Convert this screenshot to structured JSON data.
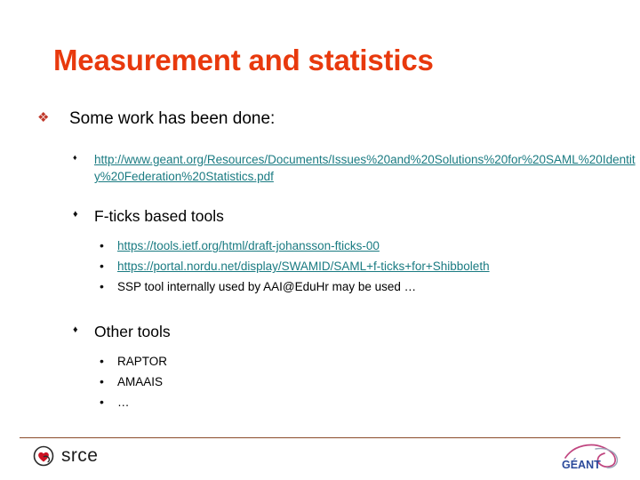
{
  "slide": {
    "title": "Measurement and statistics",
    "title_color": "#e8390d",
    "link_color": "#1a7b82",
    "rule_color": "#8a4b2a",
    "bullets": {
      "level1_glyph": "❖",
      "level2_glyph": "♦",
      "level3_glyph": "•"
    },
    "content": {
      "lvl1_item": "Some work has been done:",
      "geant_link": "http://www.geant.org/Resources/Documents/Issues%20and%20Solutions%20for%20SAML%20Identity%20Federation%20Statistics.pdf",
      "fticks_heading": "F-ticks based tools",
      "fticks_items": [
        {
          "text": "https://tools.ietf.org/html/draft-johansson-fticks-00",
          "is_link": true
        },
        {
          "text": "https://portal.nordu.net/display/SWAMID/SAML+f-ticks+for+Shibboleth",
          "is_link": true
        },
        {
          "text": "SSP tool internally used by AAI@EduHr may be used …",
          "is_link": false
        }
      ],
      "other_heading": "Other tools",
      "other_items": [
        {
          "text": "RAPTOR",
          "is_link": false
        },
        {
          "text": "AMAAIS",
          "is_link": false
        },
        {
          "text": "…",
          "is_link": false
        }
      ]
    }
  },
  "footer": {
    "srce_label": "srce",
    "geant_label": "GÉANT",
    "geant_text_color": "#2b4a9b",
    "geant_swoosh_color": "#c0457f",
    "srce_heart_color": "#cc1122"
  }
}
